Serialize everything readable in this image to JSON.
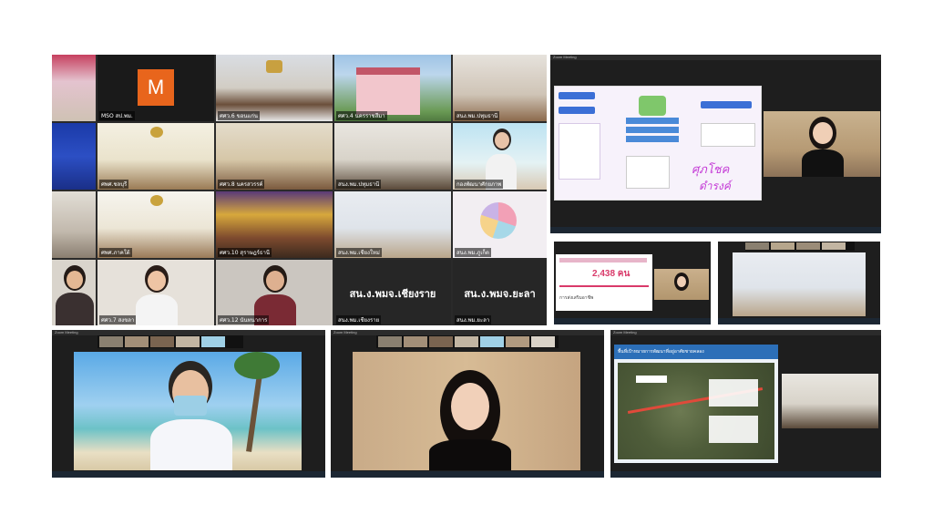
{
  "main_gallery": {
    "tiles": [
      {
        "name": ""
      },
      {
        "name": "MSO สป.พม."
      },
      {
        "name": "ศศว.6 ขอนแก่น"
      },
      {
        "name": "ศศว.4 นครราชสีมา"
      },
      {
        "name": "สนง.พม.ปทุมธานี"
      },
      {
        "name": ""
      },
      {
        "name": "ศพศ.ชลบุรี"
      },
      {
        "name": "ศศว.8 นครสวรรค์"
      },
      {
        "name": "สนง.พม.ปทุมธานี"
      },
      {
        "name": "กองพัฒนาศักยภาพ"
      },
      {
        "name": ""
      },
      {
        "name": "ศพศ.ภาคใต้"
      },
      {
        "name": "ศศว.10 สุราษฎร์ธานี"
      },
      {
        "name": "สนง.พม.เชียงใหม่"
      },
      {
        "name": "สนง.พม.ภูเก็ต"
      },
      {
        "name": ""
      },
      {
        "name": "ศศว.7 สงขลา"
      },
      {
        "name": "ศศว.12 นันทนาการ"
      },
      {
        "name": "สนง.พม.เชียงราย"
      },
      {
        "name": "สนง.พม.ยะลา"
      }
    ],
    "m_avatar_letter": "M",
    "text_tile_1": "สน.ง.พมจ.เชียงราย",
    "text_tile_2": "สน.ง.พมจ.ยะลา"
  },
  "share_top": {
    "title": "Zoom Meeting",
    "annotation": "ศุภโชค",
    "annotation2": "ดำรงค์"
  },
  "slide_small": {
    "number": "2,438 คน",
    "label": "การส่งเสริมอาชีพ"
  },
  "window_bottom_left": {
    "title": "Zoom Meeting"
  },
  "window_bottom_mid": {
    "title": "Zoom Meeting"
  },
  "window_bottom_right": {
    "title": "Zoom Meeting",
    "slide_title": "พื้นที่เป้าหมายการพัฒนาที่อยู่อาศัยชายคลอง"
  },
  "colors": {
    "accent": "#e8651c",
    "taskbar": "#1c2733",
    "slide_pink": "#d93a6a"
  }
}
